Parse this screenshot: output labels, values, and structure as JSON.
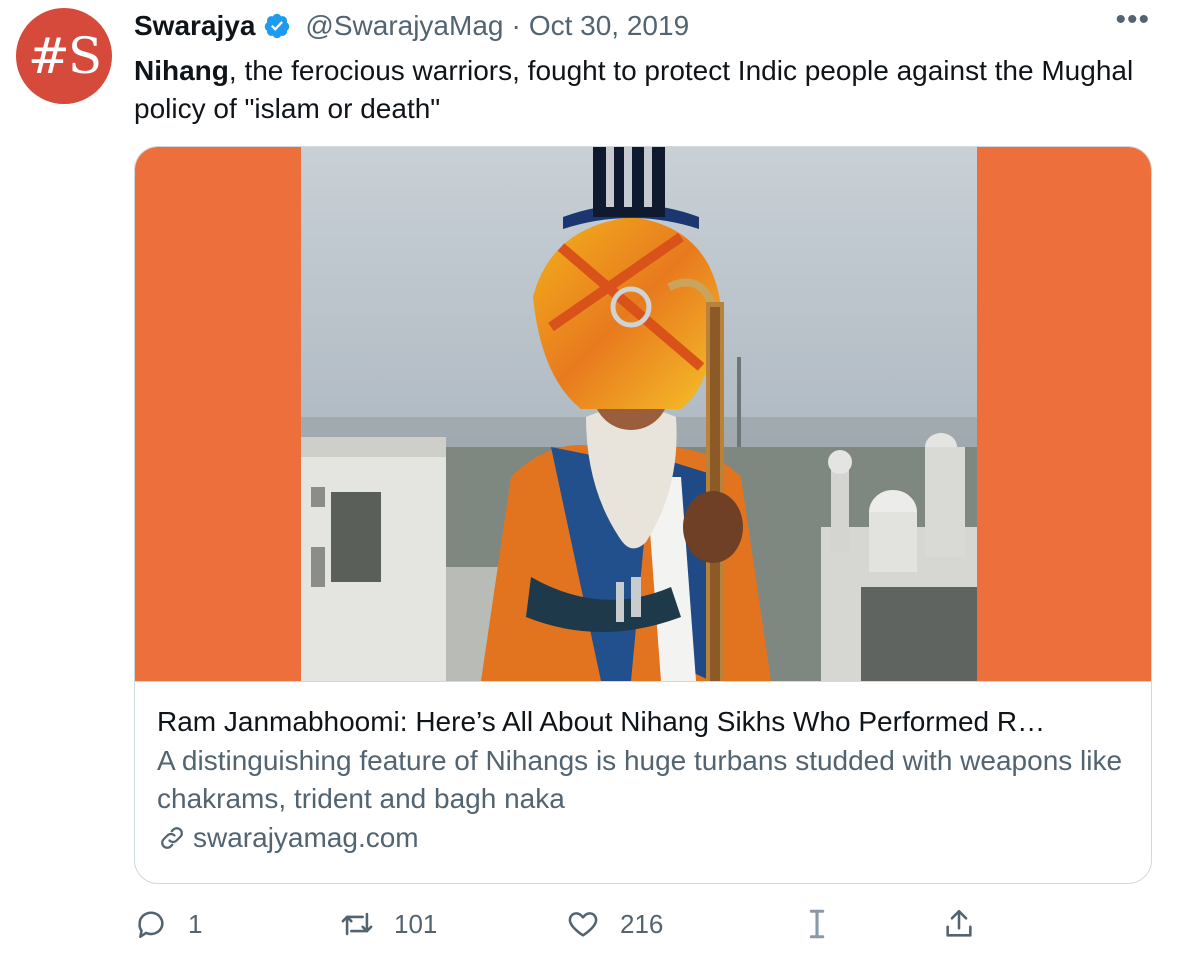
{
  "account": {
    "avatar_text": "#S",
    "name": "Swarajya",
    "handle": "@SwarajyaMag",
    "separator": "·",
    "date": "Oct 30, 2019",
    "verified": true
  },
  "tweet": {
    "bold_word": "Nihang",
    "text_rest": ", the ferocious warriors, fought to protect Indic people against the Mughal policy of \"islam or death\""
  },
  "card": {
    "title": "Ram Janmabhoomi: Here’s All About Nihang Sikhs Who Performed R…",
    "description": "A distinguishing feature of Nihangs is huge turbans studded with weapons like chakrams, trident and bagh naka",
    "domain": "swarajyamag.com",
    "background_color": "#ec6f3c"
  },
  "actions": {
    "reply_count": "1",
    "retweet_count": "101",
    "like_count": "216",
    "icons": [
      "reply-icon",
      "retweet-icon",
      "like-icon",
      "analytics-icon",
      "share-icon"
    ]
  },
  "colors": {
    "text_primary": "#0f1419",
    "text_secondary": "#536471",
    "verified_blue": "#1d9bf0",
    "avatar_red": "#d64a3b",
    "border": "#cfd9de"
  }
}
